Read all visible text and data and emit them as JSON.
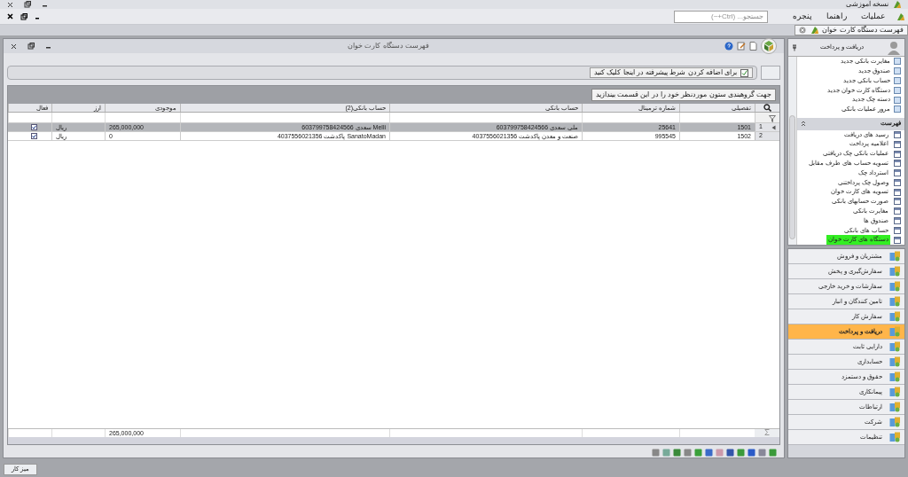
{
  "app_title": "نسخه آموزشی",
  "menu": [
    "عملیات",
    "راهنما",
    "پنجره"
  ],
  "search": {
    "placeholder": "جستجو... (Ctrl+~)"
  },
  "doc_tabs": [
    {
      "label": "فهرست دستگاه کارت خوان",
      "selected": true
    }
  ],
  "window": {
    "title": "فهرست دستگاه کارت خوان",
    "filter_hint": "برای اضافه کردن شرط پیشرفته در اینجا کلیک کنید",
    "group_hint": "جهت گروهبندی ستون موردنظر خود را در این قسمت بیندازید",
    "table": {
      "columns": [
        "تفصیلی",
        "شماره ترمینال",
        "حساب بانکی",
        "حساب بانکی(2)",
        "موجودی",
        "ارز",
        "فعال"
      ],
      "rows": [
        {
          "index": "1",
          "selected": true,
          "cells": [
            "1501",
            "25641",
            "ملی سعدی 603799758424566",
            "Melli سعدی 603799758424566",
            "265,000,000",
            "ریال"
          ],
          "active": true
        },
        {
          "index": "2",
          "selected": false,
          "cells": [
            "1502",
            "995545",
            "صنعت و معدن پاکدشت 4037556021356",
            "SanatoMadan پاکدشت 4037556021356",
            "0",
            "ریال"
          ],
          "active": true
        }
      ],
      "total": "265,000,000"
    }
  },
  "side_panel": {
    "title": "دریافت و پرداخت",
    "actions": [
      "مغایرت بانکی جدید",
      "صندوق جدید",
      "حساب بانکی جدید",
      "دستگاه کارت خوان جدید",
      "دسته چک جدید",
      "مرور عملیات بانکی"
    ],
    "list_title": "فهرست",
    "list": [
      {
        "label": "رسید های دریافت",
        "selected": false
      },
      {
        "label": "اعلامیه پرداخت",
        "selected": false
      },
      {
        "label": "عملیات بانکی چک دریافتی",
        "selected": false
      },
      {
        "label": "تسویه حساب های طرف مقابل",
        "selected": false
      },
      {
        "label": "استرداد چک",
        "selected": false
      },
      {
        "label": "وصول چک پرداختنی",
        "selected": false
      },
      {
        "label": "تسویه های کارت خوان",
        "selected": false
      },
      {
        "label": "صورت حسابهای بانکی",
        "selected": false
      },
      {
        "label": "مغایرت بانکی",
        "selected": false
      },
      {
        "label": "صندوق ها",
        "selected": false
      },
      {
        "label": "حساب های بانکی",
        "selected": false
      },
      {
        "label": "دستگاه های کارت خوان",
        "selected": true
      }
    ]
  },
  "modules": [
    {
      "label": "مشتریان و فروش",
      "selected": false
    },
    {
      "label": "سفارش‌گیری و پخش",
      "selected": false
    },
    {
      "label": "سفارشات و خرید خارجی",
      "selected": false
    },
    {
      "label": "تامین کنندگان و انبار",
      "selected": false
    },
    {
      "label": "سفارش کار",
      "selected": false
    },
    {
      "label": "دریافت و پرداخت",
      "selected": true
    },
    {
      "label": "دارایی ثابت",
      "selected": false
    },
    {
      "label": "حسابداری",
      "selected": false
    },
    {
      "label": "حقوق و دستمزد",
      "selected": false
    },
    {
      "label": "پیمانکاری",
      "selected": false
    },
    {
      "label": "ارتباطات",
      "selected": false
    },
    {
      "label": "شرکت",
      "selected": false
    },
    {
      "label": "تنظیمات",
      "selected": false
    }
  ],
  "status_bar": {
    "tab": "میز کار"
  }
}
